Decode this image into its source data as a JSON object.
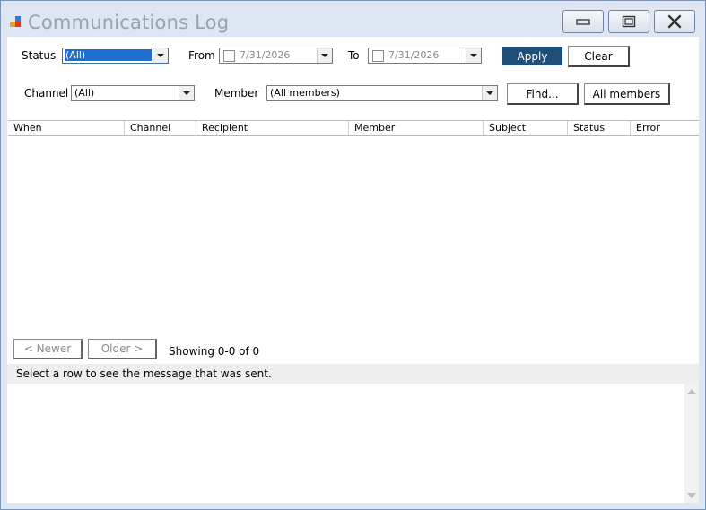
{
  "window": {
    "title": "Communications Log",
    "controls": [
      "minimize",
      "maximize",
      "close"
    ]
  },
  "filters": {
    "status_label": "Status",
    "status_value": "(All)",
    "from_label": "From",
    "from_date": "7/31/2026",
    "from_checked": false,
    "to_label": "To",
    "to_date": "7/31/2026",
    "to_checked": false,
    "apply_label": "Apply",
    "clear_label": "Clear",
    "channel_label": "Channel",
    "channel_value": "(All)",
    "member_label": "Member",
    "member_value": "(All members)",
    "find_label": "Find...",
    "all_members_label": "All members"
  },
  "grid": {
    "columns": [
      "When",
      "Channel",
      "Recipient",
      "Member",
      "Subject",
      "Status",
      "Error"
    ],
    "rows": []
  },
  "paging": {
    "newer_label": "< Newer",
    "older_label": "Older >",
    "showing": "Showing 0-0 of 0"
  },
  "detail": {
    "hint": "Select a row to see the message that was sent.",
    "body": ""
  },
  "colors": {
    "accent": "#1f4e79",
    "selection": "#1f6fd1",
    "title_text": "#9aa3ad"
  }
}
